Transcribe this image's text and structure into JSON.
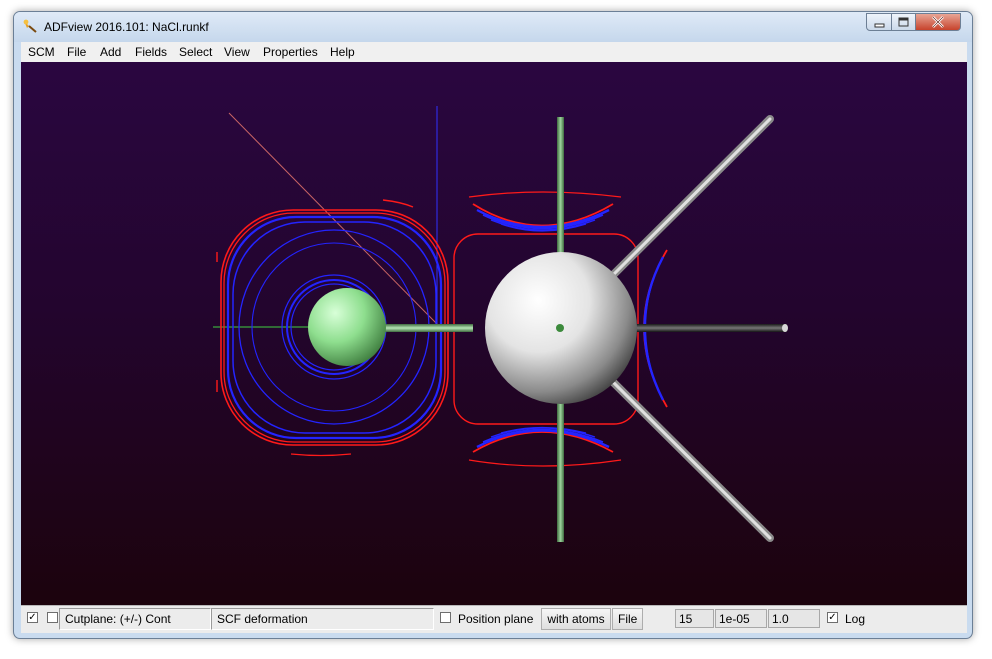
{
  "window": {
    "title": "ADFview 2016.101: NaCl.runkf"
  },
  "icons": {
    "app": "adfview-app-icon",
    "minimize": "minimize-icon",
    "maximize": "maximize-icon",
    "close": "close-icon"
  },
  "menu": [
    "SCM",
    "File",
    "Add",
    "Fields",
    "Select",
    "View",
    "Properties",
    "Help"
  ],
  "statusbar": {
    "visible_checked": true,
    "second_checked": false,
    "cutplane_label": "Cutplane: (+/-) Cont",
    "field_name": "SCF deformation",
    "position_plane_checked": false,
    "position_plane_label": "Position plane",
    "with_atoms_label": "with atoms",
    "file_label": "File",
    "contour_count": "15",
    "min_value": "1e-05",
    "max_value": "1.0",
    "log_checked": true,
    "log_label": "Log"
  },
  "colors": {
    "background_top": "#2a0640",
    "background_bottom": "#1c030d",
    "contour_positive": "#ff1a1a",
    "contour_negative": "#2424ff",
    "atom_na": "#8ee08e",
    "atom_cl": "#ffffff",
    "bond_green": "#6fa86f",
    "bond_grey": "#c8c8c8"
  }
}
